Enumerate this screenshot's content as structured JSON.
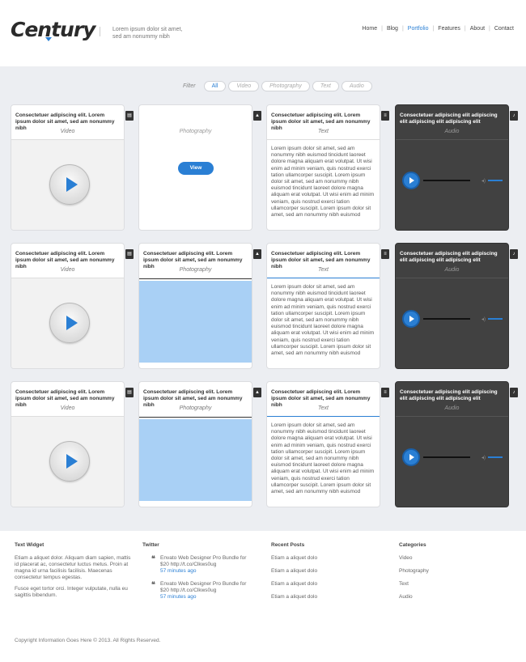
{
  "header": {
    "logo": "Century",
    "tagline1": "Lorem ipsum dolor sit amet,",
    "tagline2": "sed am nonummy nibh",
    "nav": [
      "Home",
      "Blog",
      "Portfolio",
      "Features",
      "About",
      "Contact"
    ],
    "nav_active": "Portfolio"
  },
  "filter": {
    "label": "Filter",
    "options": [
      "All",
      "Video",
      "Photography",
      "Text",
      "Audio"
    ],
    "active": "All"
  },
  "cards": {
    "title": "Consectetuer adipiscing elit. Lorem ipsum dolor sit amet, sed am nonummy nibh",
    "audio_title": "Consectetuer adipiscing elit adipiscing elit adipiscing elit adipiscing elit",
    "video_label": "Video",
    "photo_label": "Photography",
    "text_label": "Text",
    "audio_label": "Audio",
    "view_button": "View",
    "text_body": "Lorem ipsum dolor sit amet, sed am nonummy nibh euismod tincidunt laoreet dolore magna aliquam erat volutpat. Ut wisi enim ad minim veniam, quis nostrud exerci tation ullamcorper suscipit. Lorem ipsum dolor sit amet, sed am nonummy nibh euismod tincidunt laoreet dolore magna aliquam erat volutpat. Ut wisi enim ad minim veniam, quis nostrud exerci tation ullamcorper suscipit. Lorem ipsum dolor sit amet, sed am nonummy nibh euismod"
  },
  "footer": {
    "text_widget": {
      "heading": "Text Widget",
      "p1": "Etiam a aliquet dolor. Aliquam diam sapien, mattis id placerat ac, consectetur luctus metus. Proin at magna id urna facilisis facilisis. Maecenas consectetur tempus egestas.",
      "p2": "Fusce eget tortor orci. Integer vulputate, nulla eu sagittis bibendum."
    },
    "twitter": {
      "heading": "Twitter",
      "tweets": [
        {
          "text": "Envato Web Designer Pro Bundle for $20 http://t.co/Clkws0ug",
          "time": "57 minutes ago"
        },
        {
          "text": "Envato Web Designer Pro Bundle for $20 http://t.co/Clkws0ug",
          "time": "57 minutes ago"
        }
      ]
    },
    "recent_posts": {
      "heading": "Recent Posts",
      "items": [
        "Etiam a aliquet dolo",
        "Etiam a aliquet dolo",
        "Etiam a aliquet dolo",
        "Etiam a aliquet dolo"
      ]
    },
    "categories": {
      "heading": "Categories",
      "items": [
        "Video",
        "Photography",
        "Text",
        "Audio"
      ]
    },
    "copyright": "Copyright Information Goes Here © 2013. All Rights Reserved."
  },
  "colors": {
    "accent": "#2a7fd4",
    "dark_card": "#414141",
    "background": "#eceef2"
  }
}
